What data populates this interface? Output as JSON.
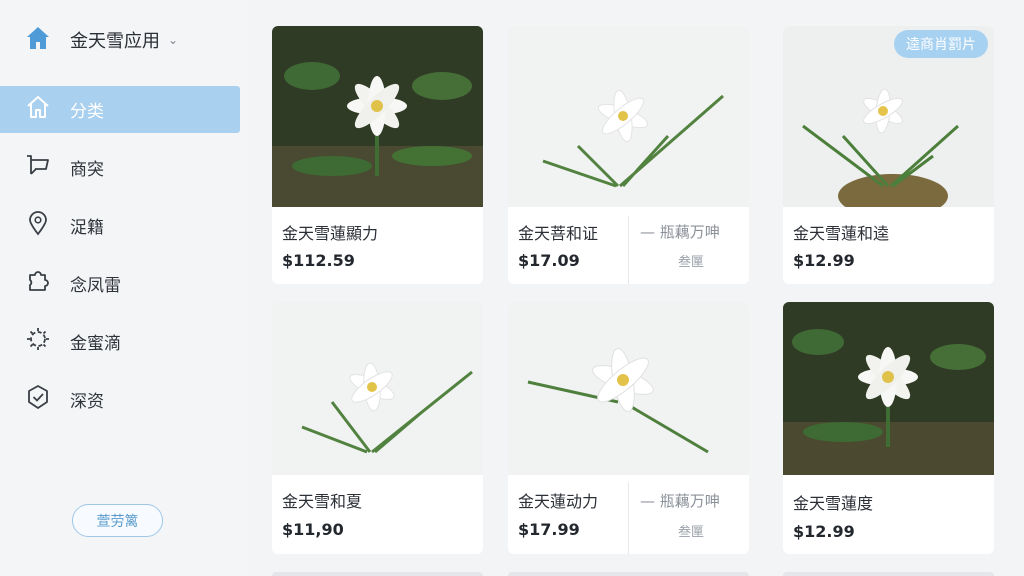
{
  "app": {
    "title": "金天雪应用",
    "chevron": "⌄"
  },
  "nav": {
    "items": [
      {
        "label": "分类",
        "icon": "home-icon",
        "active": true
      },
      {
        "label": "商突",
        "icon": "cart-icon"
      },
      {
        "label": "浞籍",
        "icon": "map-pin-icon"
      },
      {
        "label": "念凤雷",
        "icon": "puzzle-icon"
      },
      {
        "label": "金蜜滴",
        "icon": "gear-icon"
      },
      {
        "label": "深资",
        "icon": "shield-check-icon"
      }
    ]
  },
  "filter": {
    "label": "萱劳篱"
  },
  "badge": {
    "label": "逵商肖罰片"
  },
  "products": [
    {
      "name": "金天雪蓮顯力",
      "price": "$112.59",
      "photo": "dark"
    },
    {
      "name": "金天菩和证",
      "price": "$17.09",
      "photo": "light",
      "alt_text": "— 瓶藕万呻",
      "alt_sub": "叁匰"
    },
    {
      "name": "金天雪蓮和逵",
      "price": "$12.99",
      "photo": "pot"
    },
    {
      "name": "金天雪和夏",
      "price": "$11,90",
      "photo": "light"
    },
    {
      "name": "金天蓮动力",
      "price": "$17.99",
      "photo": "single",
      "alt_text": "— 瓶藕万呻",
      "alt_sub": "叁匰"
    },
    {
      "name": "金天雪蓮度",
      "price": "$12.99",
      "photo": "dark"
    }
  ],
  "colors": {
    "accent": "#a9d0ee",
    "background": "#f3f4f6",
    "card": "#ffffff"
  }
}
